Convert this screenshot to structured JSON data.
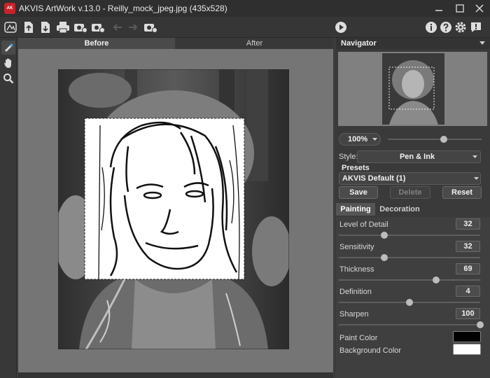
{
  "window": {
    "title": "AKVIS ArtWork v.13.0 - Reilly_mock_jpeg.jpg (435x528)"
  },
  "tabs": {
    "before": "Before",
    "after": "After"
  },
  "navigator": {
    "title": "Navigator",
    "zoom": "100%",
    "zoom_level": 0.6
  },
  "settings": {
    "style_label": "Style:",
    "style_value": "Pen & Ink",
    "presets_label": "Presets",
    "preset_value": "AKVIS Default (1)",
    "save": "Save",
    "delete": "Delete",
    "reset": "Reset"
  },
  "panel_tabs": {
    "painting": "Painting",
    "decoration": "Decoration"
  },
  "params": [
    {
      "label": "Level of Detail",
      "value": "32",
      "level": 0.32
    },
    {
      "label": "Sensitivity",
      "value": "32",
      "level": 0.32
    },
    {
      "label": "Thickness",
      "value": "69",
      "level": 0.69
    },
    {
      "label": "Definition",
      "value": "4",
      "level": 0.5
    },
    {
      "label": "Sharpen",
      "value": "100",
      "level": 1.0
    }
  ],
  "colors": {
    "paint_color_label": "Paint Color",
    "paint_color": "#000000",
    "background_color_label": "Background Color",
    "background_color": "#ffffff"
  }
}
